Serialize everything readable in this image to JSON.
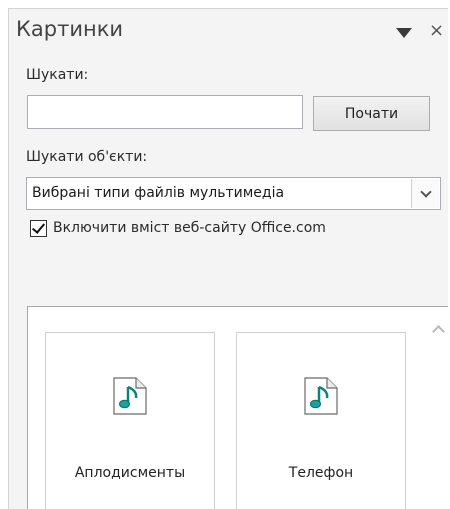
{
  "pane": {
    "title": "Картинки",
    "menu_icon": "dropdown-triangle-icon",
    "close_icon": "close-icon",
    "close_glyph": "×"
  },
  "search": {
    "label": "Шукати:",
    "value": "",
    "placeholder": "",
    "go_label": "Почати"
  },
  "filter": {
    "label": "Шукати об'єкти:",
    "selected": "Вибрані типи файлів мультимедіа"
  },
  "office_content": {
    "label": "Включити вміст веб-сайту Office.com",
    "checked": true
  },
  "results": {
    "items": [
      {
        "label": "Аплодисменты",
        "icon": "audio-file-icon"
      },
      {
        "label": "Телефон",
        "icon": "audio-file-icon"
      }
    ]
  },
  "colors": {
    "pane_bg": "#f4f4f4",
    "icon_note": "#1aa39a"
  }
}
